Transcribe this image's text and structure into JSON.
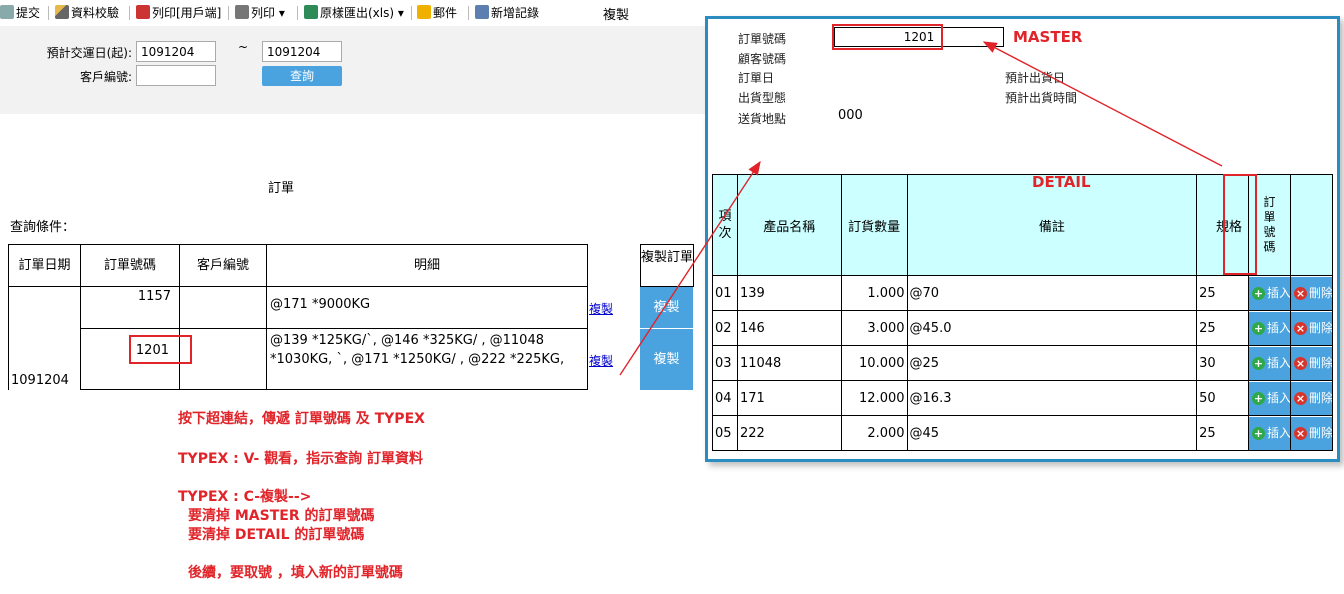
{
  "toolbar": {
    "items": [
      "提交",
      "資料校驗",
      "列印[用戶端]",
      "列印",
      "原樣匯出(xls)",
      "郵件",
      "新增記錄"
    ],
    "title": "複製"
  },
  "query": {
    "date_from_label": "預計交運日(起):",
    "date_from_value": "1091204",
    "tilde": "~",
    "date_to_value": "1091204",
    "customer_label": "客戶編號:",
    "customer_value": "",
    "search_button": "查詢"
  },
  "report": {
    "title": "訂單",
    "condition_label": "查詢條件："
  },
  "grid": {
    "headers": [
      "訂單日期",
      "訂單號碼",
      "客戶編號",
      "明細",
      "複製訂單"
    ],
    "order_date": "1091204",
    "rows": [
      {
        "order_no": "1157",
        "customer": "",
        "detail": "@171 *9000KG",
        "link": "複製",
        "button": "複製"
      },
      {
        "order_no": "1201",
        "customer": "",
        "detail": "@139 *125KG/ˋ, @146 *325KG/ , @11048 *1030KG, ˋ, @171 *1250KG/ , @222 *225KG,",
        "link": "複製",
        "button": "複製"
      }
    ]
  },
  "annotations": {
    "line1": "按下超連結，傳遞 訂單號碼 及 TYPEX",
    "line2": "TYPEX : V- 觀看，指示查詢 訂單資料",
    "line3": "TYPEX : C-複製-->",
    "line4": "要清掉 MASTER  的訂單號碼",
    "line5": "要清掉 DETAIL    的訂單號碼",
    "line6": "後續，要取號 ，填入新的訂單號碼",
    "master": "MASTER",
    "detail": "DETAIL"
  },
  "popup": {
    "order_no_label": "訂單號碼",
    "order_no_value": "1201",
    "customer_label": "顧客號碼",
    "order_date_label": "訂單日",
    "ship_date_label": "預計出貨日",
    "ship_type_label": "出貨型態",
    "ship_time_label": "預計出貨時間",
    "address_label": "送貨地點",
    "address_value": "000",
    "headers": [
      "項次",
      "產品名稱",
      "訂貨數量",
      "備註",
      "規格",
      "訂單號碼"
    ],
    "insert_label": "插入",
    "delete_label": "刪除",
    "rows": [
      {
        "seq": "01",
        "product": "139",
        "qty": "1.000",
        "note": "@70",
        "spec": "25"
      },
      {
        "seq": "02",
        "product": "146",
        "qty": "3.000",
        "note": "@45.0",
        "spec": "25"
      },
      {
        "seq": "03",
        "product": "11048",
        "qty": "10.000",
        "note": "@25",
        "spec": "30"
      },
      {
        "seq": "04",
        "product": "171",
        "qty": "12.000",
        "note": "@16.3",
        "spec": "50"
      },
      {
        "seq": "05",
        "product": "222",
        "qty": "2.000",
        "note": "@45",
        "spec": "25"
      }
    ]
  },
  "colors": {
    "accent": "#4aa3df",
    "annotation": "#e0242a",
    "detail_header": "#ccffff",
    "popup_border": "#2a8cbf"
  }
}
